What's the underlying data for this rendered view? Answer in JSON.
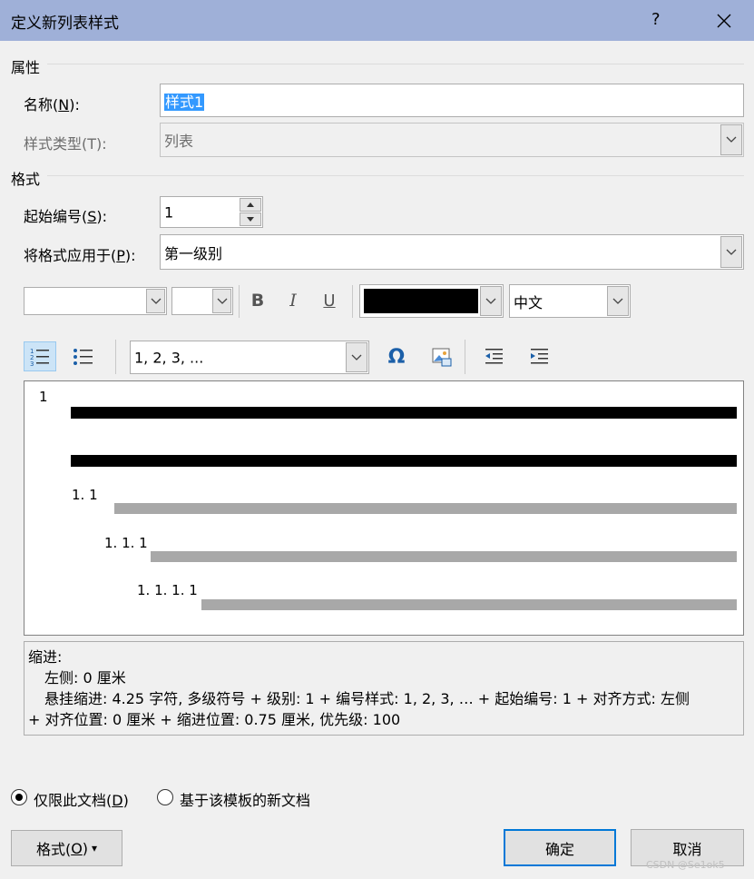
{
  "window": {
    "title": "定义新列表样式",
    "help": "?"
  },
  "properties": {
    "section_label": "属性",
    "name_label": "名称(",
    "name_key": "N",
    "name_label_end": "):",
    "name_value": "样式1",
    "type_label": "样式类型(T):",
    "type_value": "列表"
  },
  "format": {
    "section_label": "格式",
    "start_label": "起始编号(",
    "start_key": "S",
    "start_label_end": "):",
    "start_value": "1",
    "apply_label": "将格式应用于(",
    "apply_key": "P",
    "apply_label_end": "):",
    "apply_value": "第一级别"
  },
  "font_toolbar": {
    "font_name": "",
    "font_size": "",
    "bold": "B",
    "italic": "I",
    "underline": "U",
    "color": "#000000",
    "script": "中文"
  },
  "list_toolbar": {
    "numbering_style": "1, 2, 3, ...",
    "symbol": "Ω"
  },
  "preview": {
    "levels": [
      "1",
      "1. 1",
      "1. 1. 1",
      "1. 1. 1. 1"
    ]
  },
  "description": {
    "heading": "缩进:",
    "line1": "左侧:  0 厘米",
    "line2": "悬挂缩进: 4.25 字符, 多级符号 + 级别: 1 + 编号样式: 1, 2, 3, … + 起始编号: 1 + 对齐方式: 左侧",
    "line3": "+ 对齐位置:  0 厘米 + 缩进位置:  0.75 厘米, 优先级: 100"
  },
  "scope": {
    "this_doc_label": "仅限此文档(",
    "this_doc_key": "D",
    "this_doc_end": ")",
    "template_label": "基于该模板的新文档"
  },
  "buttons": {
    "format_label": "格式(",
    "format_key": "O",
    "format_end": ")",
    "format_arrow": "▾",
    "ok": "确定",
    "cancel": "取消"
  },
  "watermark": "CSDN @Se1ok5"
}
